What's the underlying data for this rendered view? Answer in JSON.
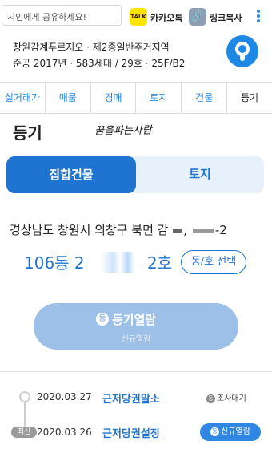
{
  "share_bar": {
    "placeholder": "지인에게 공유하세요!",
    "kakao_icon_text": "TALK",
    "kakao_label": "카카오톡",
    "link_label": "링크복사"
  },
  "complex": {
    "name": "창원감계푸르지오 · 제2종일반주거지역",
    "detail": "준공 2017년 · 583세대 / 29호 · 25F/B2"
  },
  "tabs": [
    {
      "label": "실거래가"
    },
    {
      "label": "매물"
    },
    {
      "label": "경매"
    },
    {
      "label": "토지"
    },
    {
      "label": "건물"
    },
    {
      "label": "등기"
    }
  ],
  "section_title": "등기",
  "signature": "꿈을파는사람",
  "toggle": {
    "active": "집합건물",
    "inactive": "토지"
  },
  "address": {
    "prefix": "경상남도 창원시 의창구 북면 감",
    "suffix": "-2"
  },
  "unit": {
    "dong": "106동 2",
    "ho": "2호",
    "select_label": "동/호 선택"
  },
  "view_button": {
    "icon": "등",
    "label": "등기열람",
    "sub": "신규열람"
  },
  "history": {
    "latest_badge": "최신",
    "items": [
      {
        "date": "2020.03.27",
        "title": "근저당권말소",
        "status": "조사대기",
        "status_icon": "등"
      },
      {
        "date": "2020.03.26",
        "title": "근저당권설정",
        "status": "신규열람",
        "status_icon": "등"
      }
    ]
  },
  "colors": {
    "accent": "#1f73d1",
    "button_disabled": "#9cc0e8",
    "kakao": "#fee500"
  }
}
